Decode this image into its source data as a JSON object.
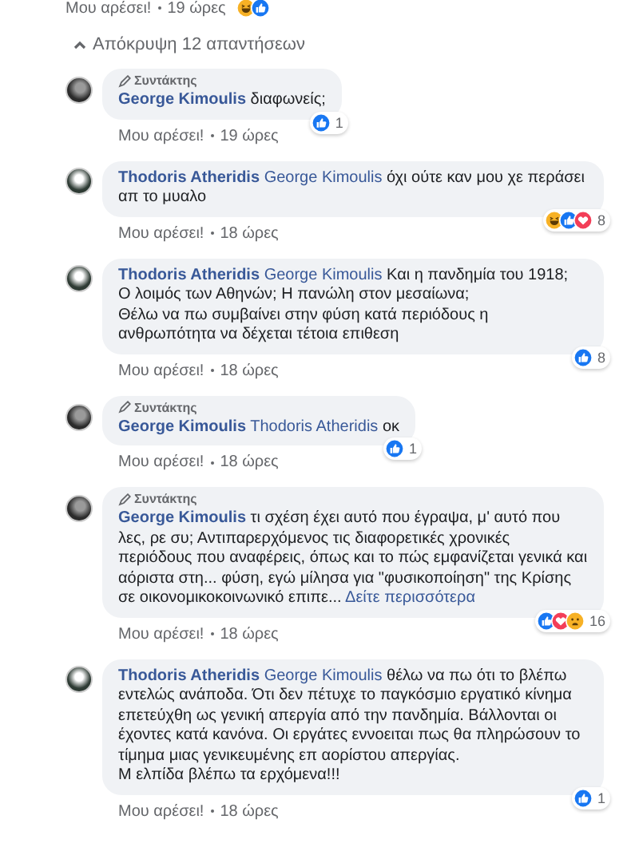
{
  "previous_footer": {
    "like": "Μου αρέσει!",
    "time": "19 ώρες",
    "reactions": [
      {
        "kind": "haha"
      },
      {
        "kind": "like"
      }
    ]
  },
  "toggle": {
    "label": "Απόκρυψη 12 απαντήσεων"
  },
  "comments": [
    {
      "badge": "Συντάκτης",
      "author": "George Kimoulis",
      "text": "διαφωνείς;",
      "reactions": [
        {
          "kind": "like"
        }
      ],
      "count": "1",
      "like": "Μου αρέσει!",
      "time": "19 ώρες"
    },
    {
      "author": "Thodoris Atheridis",
      "mention": "George Kimoulis",
      "text": "όχι ούτε καν μου χε περάσει απ το μυαλο",
      "reactions": [
        {
          "kind": "haha"
        },
        {
          "kind": "like"
        },
        {
          "kind": "love"
        }
      ],
      "count": "8",
      "like": "Μου αρέσει!",
      "time": "18 ώρες"
    },
    {
      "author": "Thodoris Atheridis",
      "mention": "George Kimoulis",
      "text": "Και η πανδημία του 1918;\nΟ λοιμός των Αθηνών; Η πανώλη στον μεσαίωνα;\nΘέλω να πω συμβαίνει στην φύση κατά περιόδους η ανθρωπότητα να δέχεται τέτοια επιθεση",
      "reactions": [
        {
          "kind": "like"
        }
      ],
      "count": "8",
      "like": "Μου αρέσει!",
      "time": "18 ώρες"
    },
    {
      "badge": "Συντάκτης",
      "author": "George Kimoulis",
      "mention": "Thodoris Atheridis",
      "text": "οκ",
      "reactions": [
        {
          "kind": "like"
        }
      ],
      "count": "1",
      "like": "Μου αρέσει!",
      "time": "18 ώρες"
    },
    {
      "badge": "Συντάκτης",
      "author": "George Kimoulis",
      "text": "τι σχέση έχει αυτό που έγραψα, μ' αυτό που λες, ρε συ; Αντιπαρερχόμενος τις διαφορετικές χρονικές περιόδους που αναφέρεις, όπως και το πώς εμφανίζεται γενικά και αόριστα στη... φύση, εγώ μίλησα για \"φυσικοποίηση\" της Κρίσης σε οικονομικοκοινωνικό επιπε...",
      "see_more": "Δείτε περισσότερα",
      "reactions": [
        {
          "kind": "like"
        },
        {
          "kind": "love"
        },
        {
          "kind": "sad"
        }
      ],
      "count": "16",
      "like": "Μου αρέσει!",
      "time": "18 ώρες"
    },
    {
      "author": "Thodoris Atheridis",
      "mention": "George Kimoulis",
      "text": "θέλω να πω ότι το βλέπω εντελώς ανάποδα. Ότι δεν πέτυχε το παγκόσμιο εργατικό κίνημα επετεύχθη ως γενική απεργία από την πανδημία. Βάλλονται οι έχοντες κατά κανόνα. Οι εργάτες εννοειται πως θα πληρώσουν το τίμημα μιας γενικευμένης επ αορίστου απεργίας.\nΜ ελπίδα βλέπω τα ερχόμενα!!!",
      "reactions": [
        {
          "kind": "like"
        }
      ],
      "count": "1",
      "like": "Μου αρέσει!",
      "time": "18 ώρες"
    }
  ]
}
